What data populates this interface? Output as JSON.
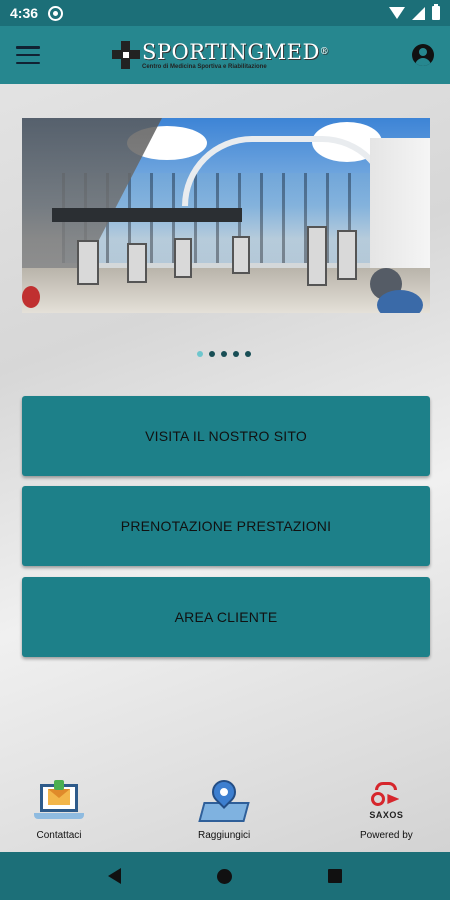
{
  "status_bar": {
    "time": "4:36"
  },
  "header": {
    "brand": "SPORTINGMED",
    "brand_mark": "®",
    "subtitle": "Centro di Medicina Sportiva e Riabilitazione"
  },
  "carousel": {
    "dots_total": 5,
    "active_index": 0
  },
  "buttons": [
    {
      "label": "VISITA IL NOSTRO SITO"
    },
    {
      "label": "PRENOTAZIONE PRESTAZIONI"
    },
    {
      "label": "AREA CLIENTE"
    }
  ],
  "footer": {
    "contact_label": "Contattaci",
    "directions_label": "Raggiungici",
    "powered_by_label": "Powered by",
    "saxos_logo_text": "SAXOS"
  },
  "colors": {
    "app_bar": "#26878f",
    "status_bar": "#1c6f78",
    "button": "#1d8089",
    "dot_active": "#6ec6cd"
  }
}
